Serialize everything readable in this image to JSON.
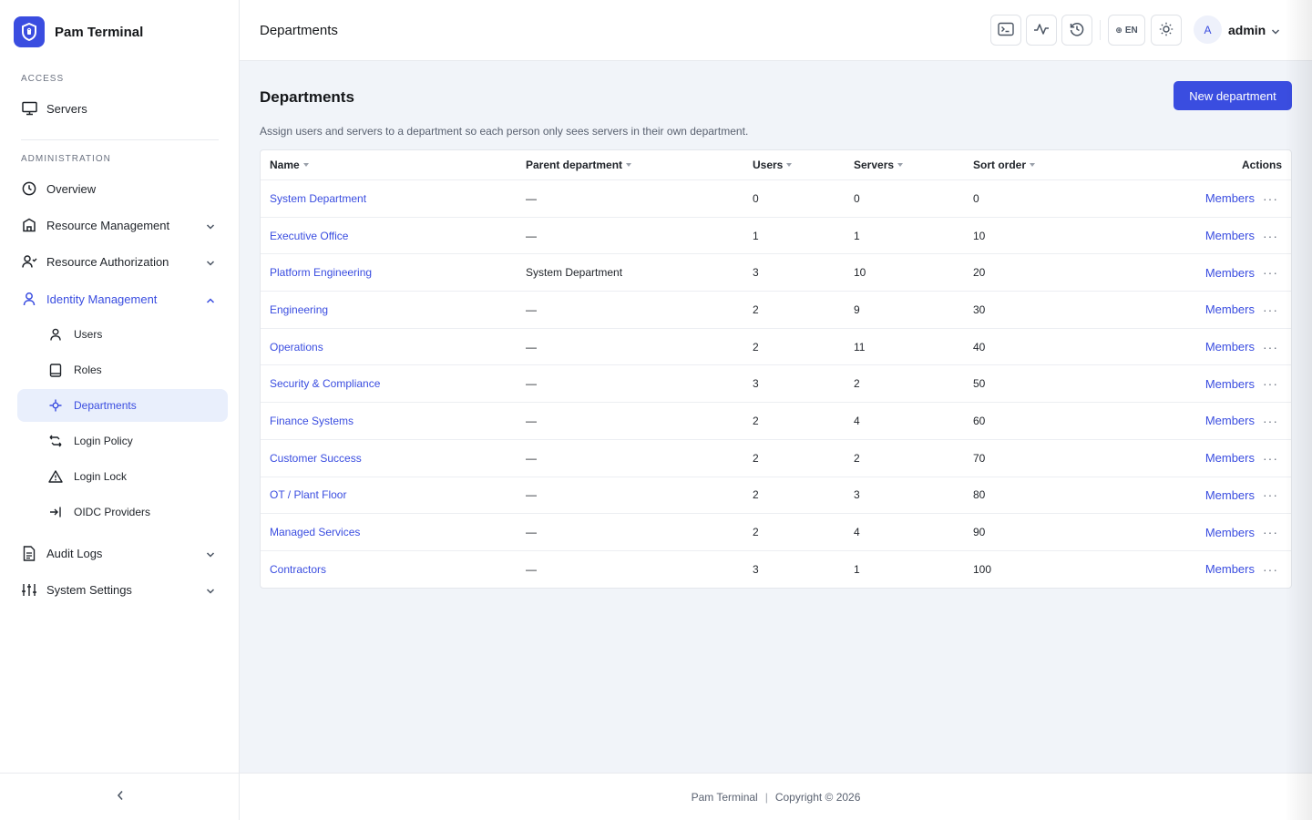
{
  "brand": {
    "name": "Pam Terminal"
  },
  "sidebar": {
    "access_label": "ACCESS",
    "servers_label": "Servers",
    "admin_label": "ADMINISTRATION",
    "items": {
      "overview": "Overview",
      "resource_management": "Resource Management",
      "resource_authorization": "Resource Authorization",
      "identity_management": "Identity Management",
      "audit_logs": "Audit Logs",
      "system_settings": "System Settings"
    },
    "identity_sub": {
      "users": "Users",
      "roles": "Roles",
      "departments": "Departments",
      "login_policy": "Login Policy",
      "login_lock": "Login Lock",
      "oidc_providers": "OIDC Providers"
    }
  },
  "header": {
    "title": "Departments",
    "lang": "EN",
    "avatar_initial": "A",
    "user": "admin"
  },
  "main": {
    "title": "Departments",
    "new_button": "New department",
    "description": "Assign users and servers to a department so each person only sees servers in their own department."
  },
  "table": {
    "columns": {
      "name": "Name",
      "parent": "Parent department",
      "users": "Users",
      "servers": "Servers",
      "sort": "Sort order",
      "actions": "Actions"
    },
    "members_label": "Members",
    "more_label": "···",
    "rows": [
      {
        "name": "System Department",
        "parent": "—",
        "users": "0",
        "servers": "0",
        "sort": "0"
      },
      {
        "name": "Executive Office",
        "parent": "—",
        "users": "1",
        "servers": "1",
        "sort": "10"
      },
      {
        "name": "Platform Engineering",
        "parent": "System Department",
        "users": "3",
        "servers": "10",
        "sort": "20"
      },
      {
        "name": "Engineering",
        "parent": "—",
        "users": "2",
        "servers": "9",
        "sort": "30"
      },
      {
        "name": "Operations",
        "parent": "—",
        "users": "2",
        "servers": "11",
        "sort": "40"
      },
      {
        "name": "Security & Compliance",
        "parent": "—",
        "users": "3",
        "servers": "2",
        "sort": "50"
      },
      {
        "name": "Finance Systems",
        "parent": "—",
        "users": "2",
        "servers": "4",
        "sort": "60"
      },
      {
        "name": "Customer Success",
        "parent": "—",
        "users": "2",
        "servers": "2",
        "sort": "70"
      },
      {
        "name": "OT / Plant Floor",
        "parent": "—",
        "users": "2",
        "servers": "3",
        "sort": "80"
      },
      {
        "name": "Managed Services",
        "parent": "—",
        "users": "2",
        "servers": "4",
        "sort": "90"
      },
      {
        "name": "Contractors",
        "parent": "—",
        "users": "3",
        "servers": "1",
        "sort": "100"
      }
    ]
  },
  "footer": {
    "brand": "Pam Terminal",
    "sep": "|",
    "copyright": "Copyright © 2026"
  },
  "colors": {
    "accent": "#3a4de0",
    "background": "#f1f4f9",
    "selected_bg": "#e9effc"
  }
}
